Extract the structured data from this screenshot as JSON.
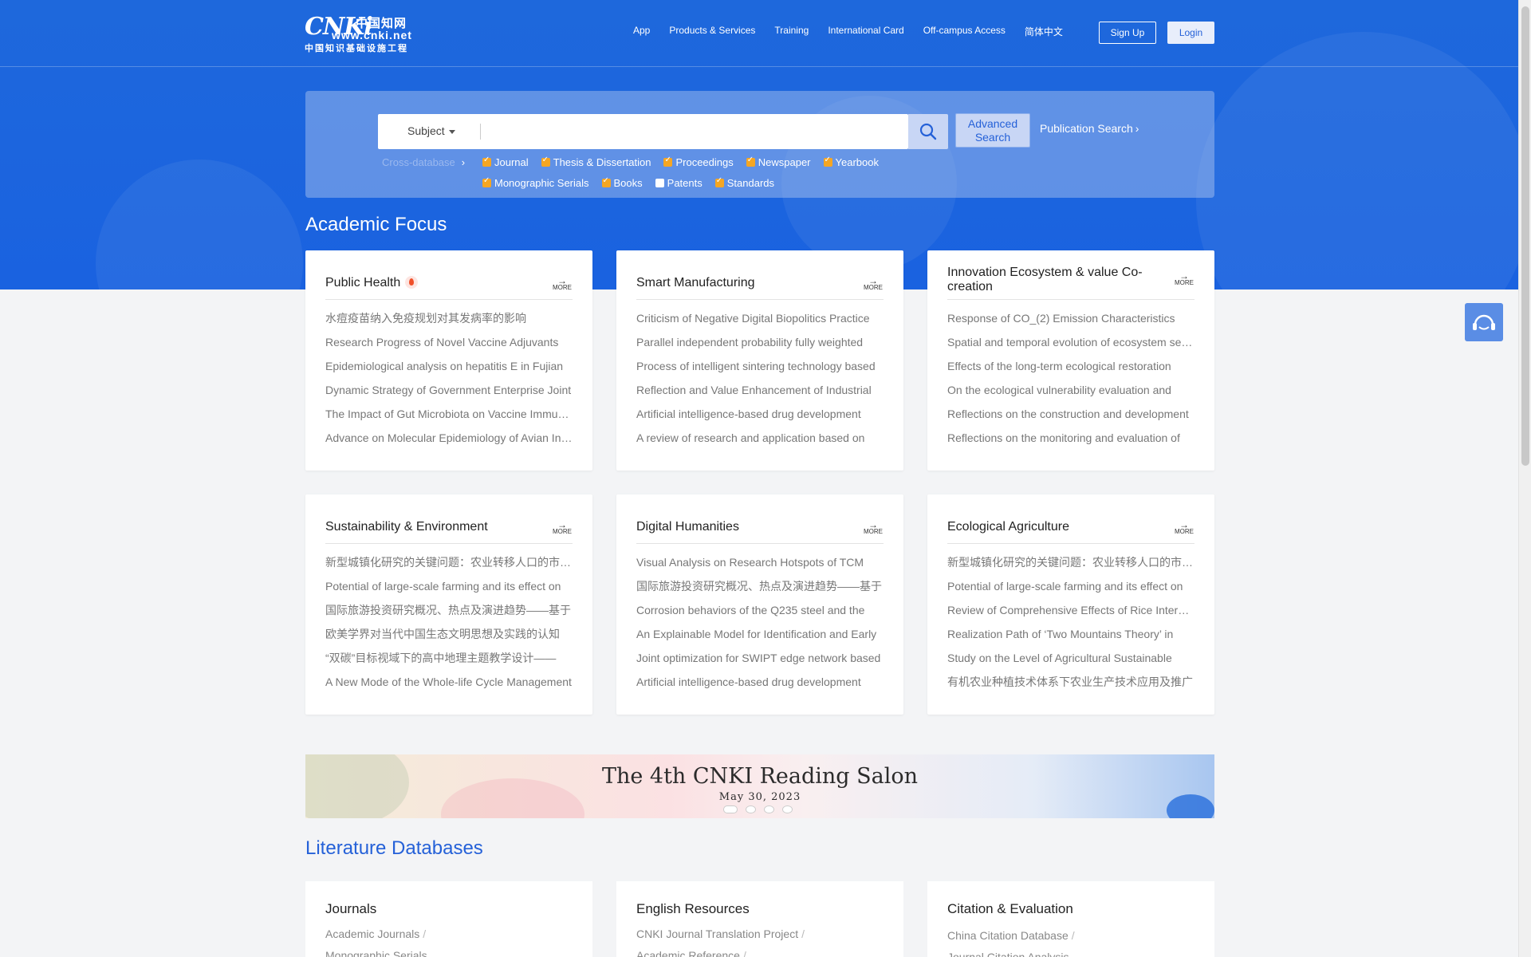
{
  "header": {
    "logo": {
      "mark": "CNKi",
      "cn_name": "中国知网",
      "url": "www.cnki.net",
      "subtitle": "中国知识基础设施工程"
    },
    "nav": [
      "App",
      "Products & Services",
      "Training",
      "International Card",
      "Off-campus Access",
      "简体中文"
    ],
    "signup_label": "Sign Up",
    "login_label": "Login"
  },
  "search": {
    "field_select": "Subject",
    "placeholder": "",
    "advanced_label": "Advanced Search",
    "publication_search": "Publication Search",
    "cross_database": "Cross-database",
    "databases_row1": [
      {
        "label": "Journal",
        "checked": true
      },
      {
        "label": "Thesis & Dissertation",
        "checked": true
      },
      {
        "label": "Proceedings",
        "checked": true
      },
      {
        "label": "Newspaper",
        "checked": true
      },
      {
        "label": "Yearbook",
        "checked": true
      }
    ],
    "databases_row2": [
      {
        "label": "Monographic Serials",
        "checked": true
      },
      {
        "label": "Books",
        "checked": true
      },
      {
        "label": "Patents",
        "checked": false
      },
      {
        "label": "Standards",
        "checked": true
      }
    ]
  },
  "academic_focus": {
    "title": "Academic Focus",
    "more_label": "MORE",
    "cards": [
      {
        "title": "Public Health",
        "hot": true,
        "items": [
          "水痘疫苗纳入免疫规划对其发病率的影响",
          "Research Progress of Novel Vaccine Adjuvants",
          "Epidemiological analysis on hepatitis E in Fujian",
          "Dynamic Strategy of Government Enterprise Joint",
          "The Impact of Gut Microbiota on Vaccine Immunity",
          "Advance on Molecular Epidemiology of Avian Influenza"
        ]
      },
      {
        "title": "Smart Manufacturing",
        "hot": false,
        "items": [
          "Criticism of Negative Digital Biopolitics Practice",
          "Parallel independent probability fully weighted",
          "Process of intelligent sintering technology based",
          "Reflection and Value Enhancement of Industrial",
          "Artificial intelligence-based drug development",
          "A review of research and application based on"
        ]
      },
      {
        "title": "Innovation Ecosystem & value Co-creation",
        "hot": false,
        "items": [
          "Response of CO_(2) Emission Characteristics",
          "Spatial and temporal evolution of ecosystem services",
          "Effects of the long-term ecological restoration",
          "On the ecological vulnerability evaluation and",
          "Reflections on the construction and development",
          "Reflections on the monitoring and evaluation of"
        ]
      },
      {
        "title": "Sustainability & Environment",
        "hot": false,
        "items": [
          "新型城镇化研究的关键问题：农业转移人口的市民化",
          "Potential of large-scale farming and its effect on",
          "国际旅游投资研究概况、热点及演进趋势——基于",
          "欧美学界对当代中国生态文明思想及实践的认知",
          "“双碳”目标视域下的高中地理主题教学设计——",
          "A New Mode of the Whole-life Cycle Management"
        ]
      },
      {
        "title": "Digital Humanities",
        "hot": false,
        "items": [
          "Visual Analysis on Research Hotspots of TCM",
          "国际旅游投资研究概况、热点及演进趋势——基于",
          "Corrosion behaviors of the Q235 steel and the",
          "An Explainable Model for Identification and Early",
          "Joint optimization for SWIPT edge network based",
          "Artificial intelligence-based drug development"
        ]
      },
      {
        "title": "Ecological Agriculture",
        "hot": false,
        "items": [
          "新型城镇化研究的关键问题：农业转移人口的市民化",
          "Potential of large-scale farming and its effect on",
          "Review of Comprehensive Effects of Rice Intercropping",
          "Realization Path of ‘Two Mountains Theory’ in",
          "Study on the Level of Agricultural Sustainable",
          "有机农业种植技术体系下农业生产技术应用及推广"
        ]
      }
    ]
  },
  "banner": {
    "title": "The 4th CNKI Reading Salon",
    "date": "May 30, 2023",
    "slide_count": 4,
    "active_slide": 1
  },
  "literature_databases": {
    "title": "Literature Databases",
    "cards": [
      {
        "title": "Journals",
        "items": [
          "Academic Journals",
          "Monographic Serials"
        ]
      },
      {
        "title": "English Resources",
        "items": [
          "CNKI Journal Translation Project",
          "Academic Reference"
        ]
      },
      {
        "title": "Citation & Evaluation",
        "items": [
          "China Citation Database",
          "Journal Citation Analysis"
        ]
      }
    ]
  },
  "colors": {
    "hero_blue": "#1e68dc",
    "accent_blue": "#2561d8",
    "checkbox_orange": "#f5a623",
    "hot_red": "#f0502a"
  }
}
